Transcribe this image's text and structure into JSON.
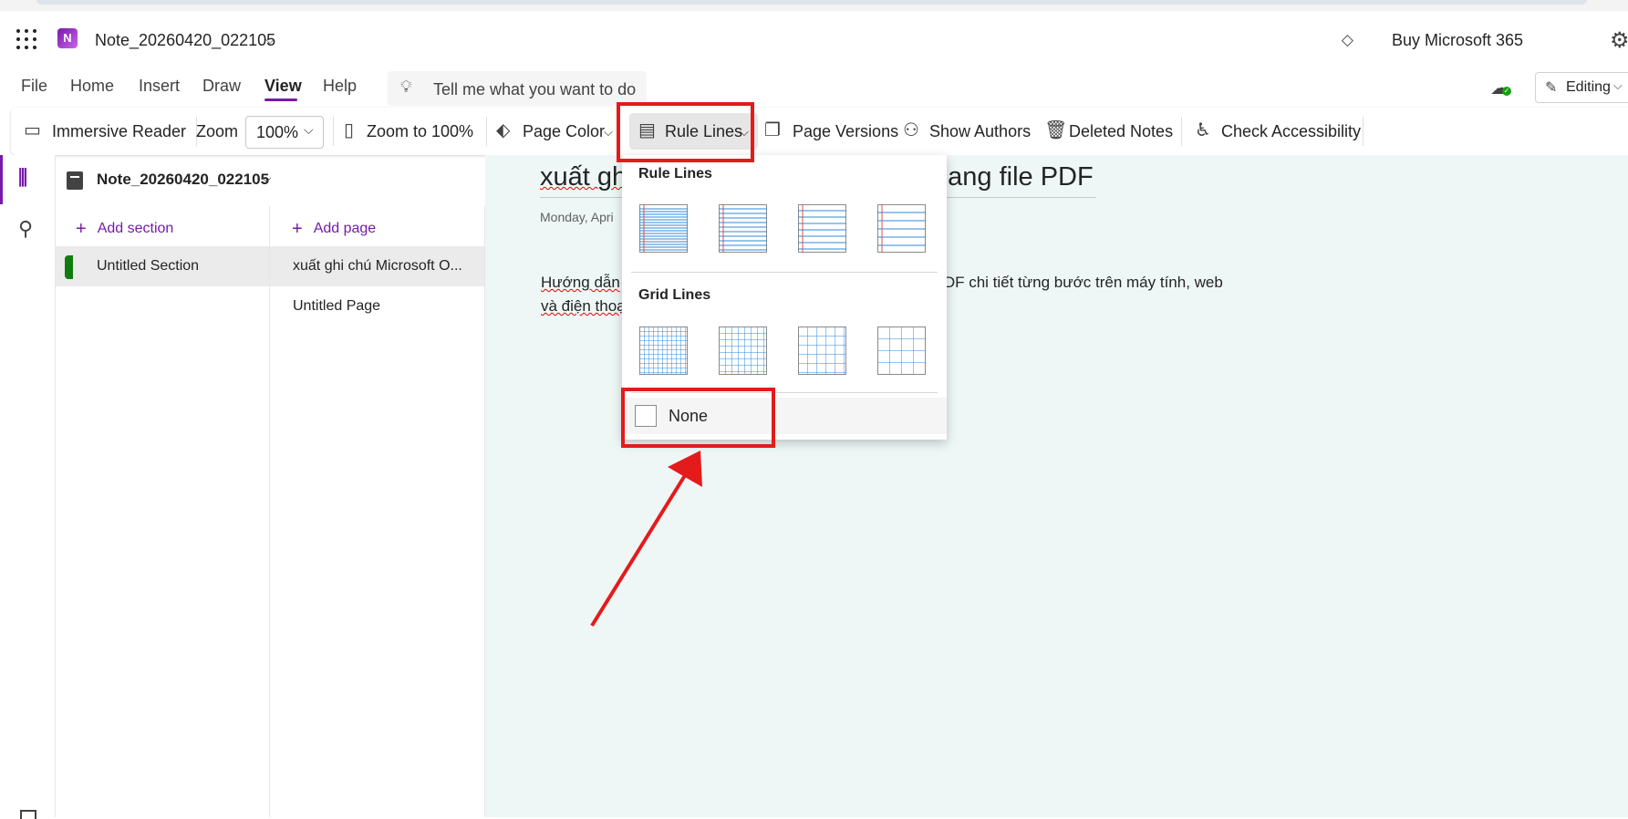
{
  "app": {
    "title": "Note_20260420_022105",
    "buy_label": "Buy Microsoft 365",
    "accent_color": "#7719aa"
  },
  "icons": {
    "waffle": "app-launcher-icon",
    "logo": "onenote-logo",
    "logo_letter": "N",
    "diamond": "diamond-icon",
    "gear": "settings-icon",
    "bulb": "lightbulb-icon",
    "cloud": "cloud-sync-icon",
    "pen": "pencil-icon"
  },
  "menu": {
    "tabs": [
      "File",
      "Home",
      "Insert",
      "Draw",
      "View",
      "Help"
    ],
    "active_tab": "View",
    "search_placeholder": "Tell me what you want to do",
    "editing_label": "Editing"
  },
  "ribbon": {
    "immersive_reader": "Immersive Reader",
    "zoom_label": "Zoom",
    "zoom_value": "100%",
    "zoom_to_100": "Zoom to 100%",
    "page_color": "Page Color",
    "rule_lines": "Rule Lines",
    "page_versions": "Page Versions",
    "show_authors": "Show Authors",
    "deleted_notes": "Deleted Notes",
    "check_accessibility": "Check Accessibility"
  },
  "nav": {
    "notebook_name": "Note_20260420_022105",
    "add_section": "Add section",
    "add_page": "Add page",
    "sections": [
      {
        "label": "Untitled Section",
        "color": "#107c10"
      }
    ],
    "pages": [
      {
        "label": "xuất ghi chú Microsoft O...",
        "selected": true
      },
      {
        "label": "Untitled Page",
        "selected": false
      }
    ]
  },
  "page": {
    "title_left": "xuất gh",
    "title_right": "ang file PDF",
    "date": "Monday, Apri",
    "body_line1_left": "Hướng dẫn",
    "body_line1_right": "DF chi tiết từng bước trên máy tính, web",
    "body_line2_left": "và điện thoại",
    "canvas_color": "#eef7f6"
  },
  "dropdown": {
    "rule_lines_heading": "Rule Lines",
    "grid_lines_heading": "Grid Lines",
    "none_label": "None",
    "rule_line_color": "#2f8ad8",
    "margin_line_color": "#d9534f",
    "rule_options": [
      "narrow-ruled",
      "college-ruled",
      "standard-ruled",
      "wide-ruled"
    ],
    "grid_options": [
      "small-grid",
      "medium-grid",
      "large-grid",
      "very-large-grid"
    ]
  },
  "annotation": {
    "highlight_color": "#e41b1b"
  }
}
